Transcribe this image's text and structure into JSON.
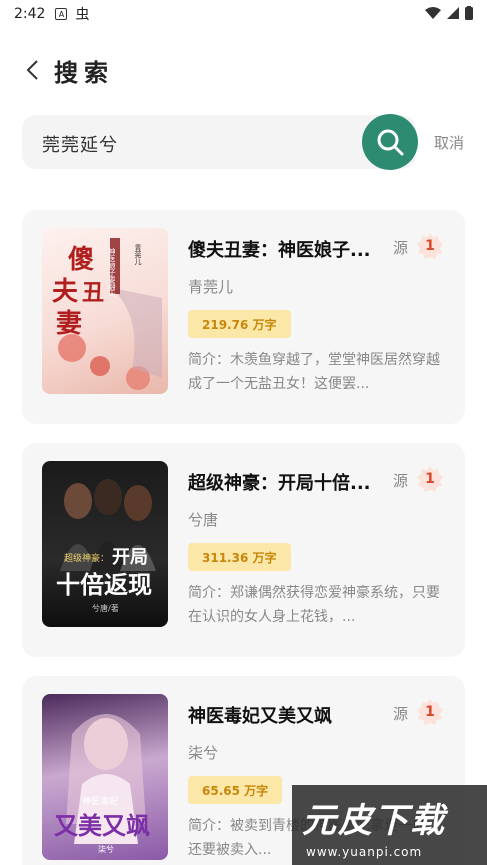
{
  "status_bar": {
    "time": "2:42",
    "icons": [
      "a-icon",
      "bug-icon",
      "wifi-icon",
      "signal-icon",
      "battery-icon"
    ]
  },
  "header": {
    "title": "搜索",
    "back_icon": "chevron-left-icon"
  },
  "search": {
    "query": "莞莞延兮",
    "button_icon": "search-icon",
    "cancel_label": "取消"
  },
  "results": [
    {
      "title": "傻夫丑妻：神医娘子...",
      "source_label": "源",
      "source_count": "1",
      "author": "青莞儿",
      "words": "219.76 万字",
      "description": "简介：木羡鱼穿越了，堂堂神医居然穿越成了一个无盐丑女！这便罢...",
      "cover_text": "傻夫丑妻",
      "cover_subtext": "神医娘子要翻天",
      "cover_author": "青莞儿"
    },
    {
      "title": "超级神豪：开局十倍...",
      "source_label": "源",
      "source_count": "1",
      "author": "兮唐",
      "words": "311.36 万字",
      "description": "简介：郑谦偶然获得恋爱神豪系统，只要在认识的女人身上花钱，...",
      "cover_text": "开局十倍返现",
      "cover_subtext": "超级神豪：",
      "cover_author": "兮唐/著"
    },
    {
      "title": "神医毒妃又美又飒",
      "source_label": "源",
      "source_count": "1",
      "author": "柒兮",
      "words": "65.65 万字",
      "description": "简介：被卖到青楼的神医毒妃拿走一血，还要被卖入...",
      "cover_text": "又美又飒",
      "cover_subtext": "神医毒妃",
      "cover_author": "柒兮"
    }
  ],
  "watermark": {
    "big": "元皮下载",
    "small": "www.yuanpi.com"
  },
  "colors": {
    "accent": "#2d8b72",
    "badge": "#fbe7a8",
    "badge_text": "#c8860a",
    "source_badge": "#d9472b"
  }
}
